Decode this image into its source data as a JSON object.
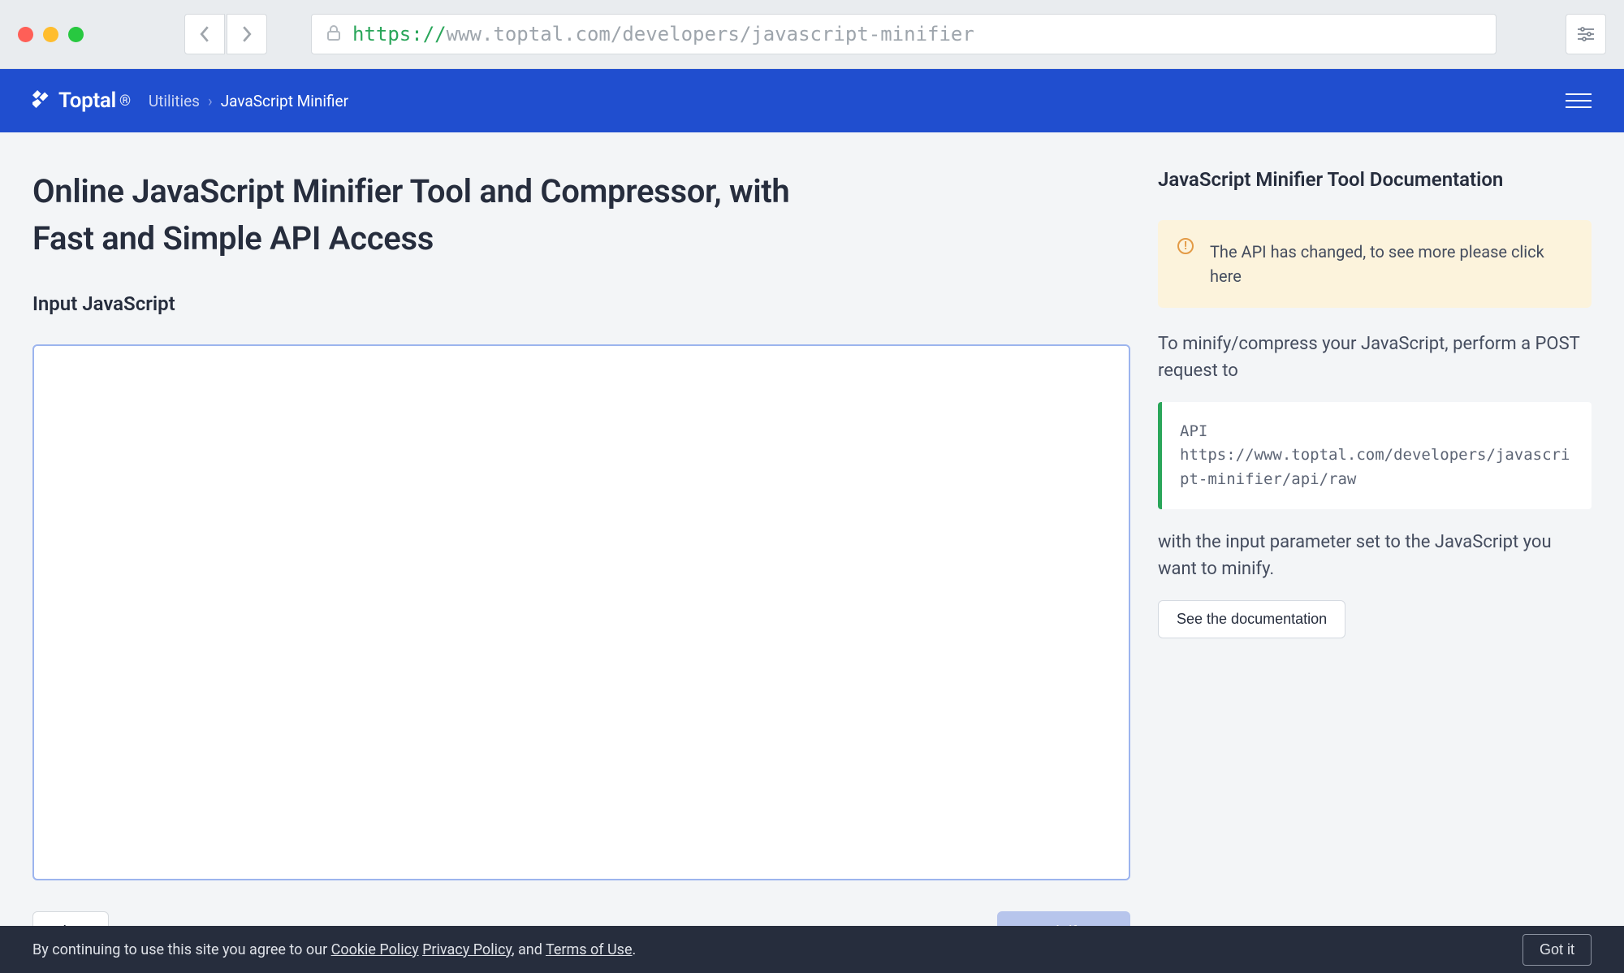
{
  "browser": {
    "url_scheme": "https://",
    "url_rest": "www.toptal.com/developers/javascript-minifier"
  },
  "header": {
    "logo_text": "Toptal",
    "breadcrumb": {
      "root": "Utilities",
      "current": "JavaScript Minifier"
    }
  },
  "page": {
    "title": "Online JavaScript Minifier Tool and Compressor, with Fast and Simple API Access",
    "input_heading": "Input JavaScript",
    "clear_label": "Clear",
    "minify_label": "Minify"
  },
  "sidebar": {
    "heading": "JavaScript Minifier Tool Documentation",
    "alert": "The API has changed, to see more please click here",
    "intro": "To minify/compress your JavaScript, perform a POST request to",
    "code_label": "API",
    "code_url": "https://www.toptal.com/developers/javascript-minifier/api/raw",
    "outro": "with the input parameter set to the JavaScript you want to minify.",
    "docs_button": "See the documentation"
  },
  "cookie": {
    "prefix": "By continuing to use this site you agree to our ",
    "cookie_policy": "Cookie Policy",
    "privacy_policy": "Privacy Policy",
    "mid": ", and ",
    "terms": "Terms of Use",
    "suffix": ".",
    "button": "Got it"
  }
}
